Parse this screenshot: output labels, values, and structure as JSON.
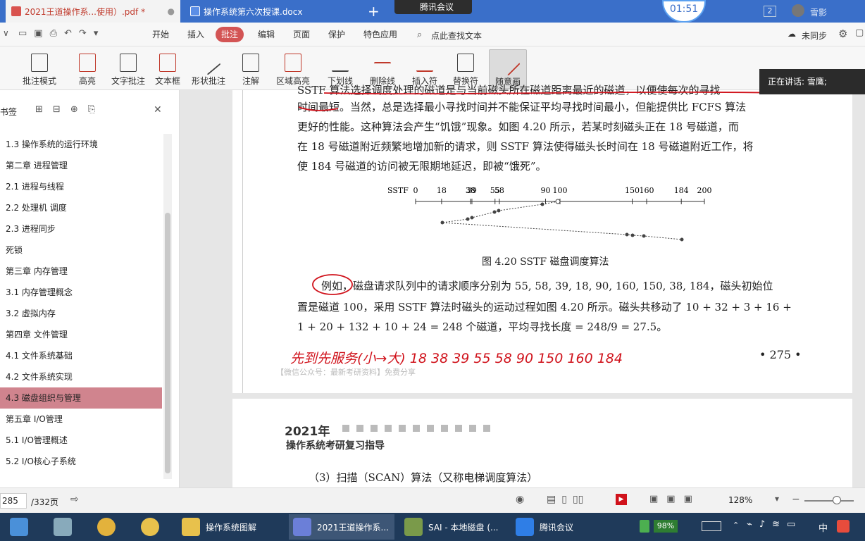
{
  "tabs": [
    {
      "label": "2021王道操作系...使用）.pdf *"
    },
    {
      "label": "操作系统第六次授课.docx"
    }
  ],
  "meeting": {
    "label": "腾讯会议",
    "timer": "01:51",
    "speaking": "正在讲话: 雪鹰;"
  },
  "user": {
    "badge": "2",
    "name": "雪影"
  },
  "menu": [
    "开始",
    "插入",
    "批注",
    "编辑",
    "页面",
    "保护",
    "特色应用"
  ],
  "search_placeholder": "点此查找文本",
  "sync": "未同步",
  "ribbon": [
    "批注模式",
    "高亮",
    "文字批注",
    "文本框",
    "形状批注",
    "注解",
    "区域高亮",
    "下划线",
    "删除线",
    "插入符",
    "替换符",
    "随意画"
  ],
  "sidebar": {
    "title": "书签",
    "items": [
      "1.3 操作系统的运行环境",
      "第二章  进程管理",
      "2.1 进程与线程",
      "2.2 处理机 调度",
      "2.3 进程同步",
      "死锁",
      "第三章 内存管理",
      "3.1 内存管理概念",
      "3.2 虚拟内存",
      "第四章 文件管理",
      "4.1 文件系统基础",
      "4.2 文件系统实现",
      "4.3 磁盘组织与管理",
      "第五章 I/O管理",
      "5.1 I/O管理概述",
      "5.2 I/O核心子系统"
    ]
  },
  "doc": {
    "line0": "SSTF 算法选择调度处理的磁道是与当前磁头所在磁道距离最近的磁道，以便使每次的寻找",
    "line1": "时间最短。当然，总是选择最小寻找时间并不能保证平均寻找时间最小，但能提供比 FCFS 算法",
    "line2": "更好的性能。这种算法会产生“饥饿”现象。如图 4.20 所示，若某时刻磁头正在 18 号磁道，而",
    "line3": "在 18 号磁道附近频繁地增加新的请求，则 SSTF 算法使得磁头长时间在 18 号磁道附近工作，将",
    "line4": "使 184 号磁道的访问被无限期地延迟，即被“饿死”。",
    "fig_prefix": "SSTF",
    "fig_ticks": [
      "0",
      "18",
      "38",
      "39",
      "55",
      "58",
      "90",
      "100",
      "150",
      "160",
      "184",
      "200"
    ],
    "caption": "图 4.20    SSTF 磁盘调度算法",
    "ex1": "例如，磁盘请求队列中的请求顺序分别为 55, 58, 39, 18, 90, 160, 150, 38, 184，磁头初始位",
    "ex2": "置是磁道 100，采用 SSTF 算法时磁头的运动过程如图 4.20 所示。磁头共移动了 10 + 32 + 3 + 16 +",
    "ex3": "1 + 20 + 132 + 10 + 24 = 248 个磁道，平均寻找长度 = 248/9 = 27.5。",
    "handwriting": "先到先服务(小→大)   18   38   39   55   58   90   150   160   184",
    "page_number": "• 275 •",
    "watermark": "【微信公众号：最新考研资料】免费分享",
    "p2_year": "2021年",
    "p2_title": "操作系统考研复习指导",
    "p2_line": "（3）扫描（SCAN）算法（又称电梯调度算法）"
  },
  "status": {
    "page": "285",
    "total": "/332页",
    "zoom": "128%"
  },
  "taskbar": [
    "操作系统图解",
    "2021王道操作系...",
    "SAI - 本地磁盘 (...",
    "腾讯会议"
  ],
  "tray": {
    "battery": "98%",
    "ime": "中"
  }
}
